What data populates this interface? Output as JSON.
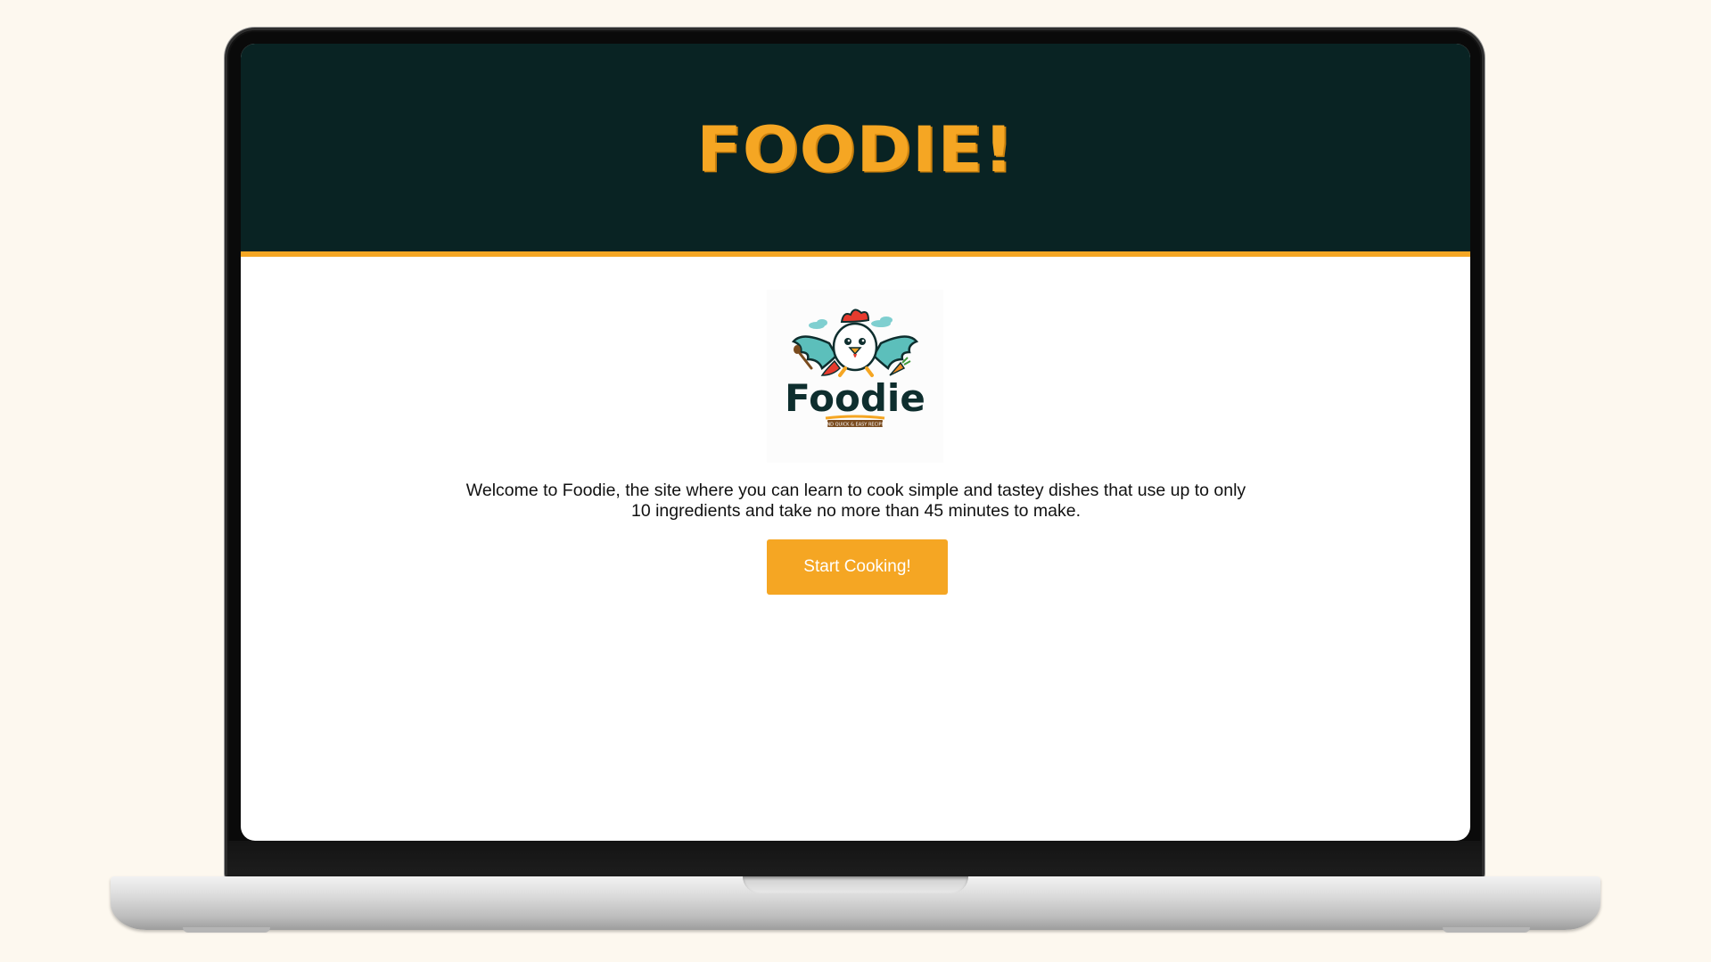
{
  "site": {
    "title": "FOODIE!",
    "welcome_text": "Welcome to Foodie, the site where you can learn to cook simple and tastey dishes that use up to only 10 ingredients and take no more than 45 minutes to make.",
    "start_button_label": "Start Cooking!"
  },
  "logo": {
    "wordmark": "Foodie",
    "tagline": "FIND QUICK & EASY RECIPES",
    "icon": "chicken-chef-logo"
  },
  "colors": {
    "header_bg": "#092323",
    "accent": "#f5a623",
    "page_bg": "#fdf8ef",
    "screen_bg": "#ffffff"
  }
}
